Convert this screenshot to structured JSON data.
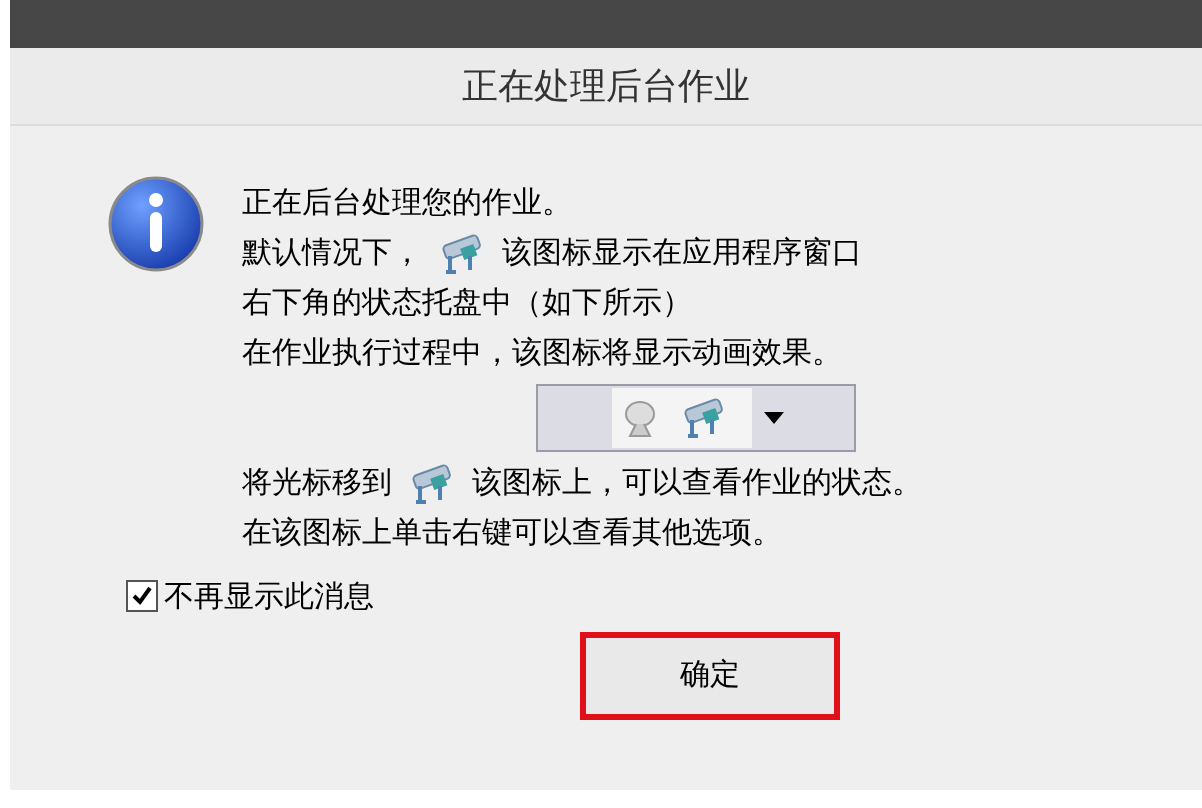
{
  "dialog": {
    "title": "正在处理后台作业"
  },
  "message": [
    {
      "kind": "text",
      "text": "正在后台处理您的作业。"
    },
    {
      "kind": "icon_text",
      "before": "默认情况下，",
      "after": "该图标显示在应用程序窗口"
    },
    {
      "kind": "text",
      "text": "右下角的状态托盘中（如下所示）"
    },
    {
      "kind": "text",
      "text": "在作业执行过程中，该图标将显示动画效果。"
    },
    {
      "kind": "tray"
    },
    {
      "kind": "icon_text",
      "before": "将光标移到",
      "after": "该图标上，可以查看作业的状态。"
    },
    {
      "kind": "text",
      "text": "在该图标上单击右键可以查看其他选项。"
    }
  ],
  "checkbox": {
    "label": "不再显示此消息",
    "checked": true
  },
  "button": {
    "label": "确定",
    "highlighted": true
  }
}
